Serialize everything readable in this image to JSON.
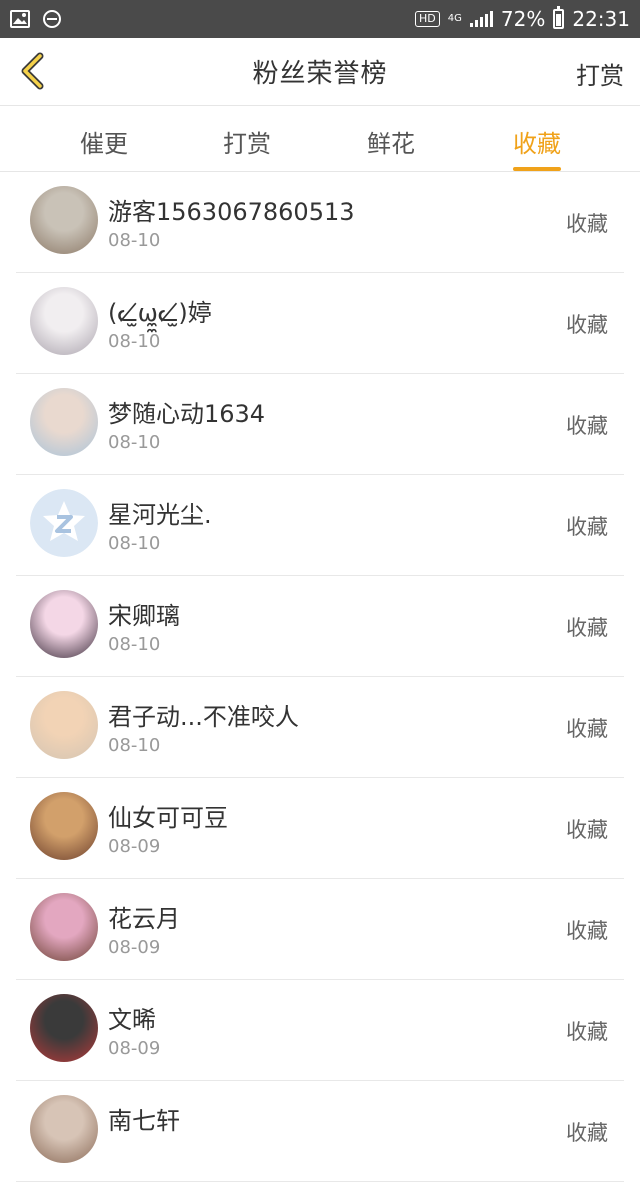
{
  "status_bar": {
    "hd": "HD",
    "network": "4G",
    "battery": "72%",
    "battery_level": 0.72,
    "time": "22:31",
    "icons": [
      "image-icon",
      "minus-circle-icon",
      "signal-icon",
      "battery-icon"
    ]
  },
  "header": {
    "title": "粉丝荣誉榜",
    "action": "打赏",
    "back_icon": "chevron-left-icon",
    "accent": "#f0a21a"
  },
  "tabs": [
    {
      "label": "催更",
      "active": false
    },
    {
      "label": "打赏",
      "active": false
    },
    {
      "label": "鲜花",
      "active": false
    },
    {
      "label": "收藏",
      "active": true
    }
  ],
  "fans": [
    {
      "name": "游客1563067860513",
      "date": "08-10",
      "action": "收藏",
      "avatar_colors": [
        "#c9c2b7",
        "#8b7866"
      ]
    },
    {
      "name": "(ᓚ̸̫ω̼̼ᓚ̸̫)婷",
      "date": "08-10",
      "action": "收藏",
      "avatar_colors": [
        "#f1eef0",
        "#aaa3ad"
      ]
    },
    {
      "name": "梦随心动1634",
      "date": "08-10",
      "action": "收藏",
      "avatar_colors": [
        "#e9d9cf",
        "#a9c3d9"
      ]
    },
    {
      "name": "星河光尘.",
      "date": "08-10",
      "action": "收藏",
      "avatar_colors": [
        "#dce8f5",
        "#dce8f5"
      ]
    },
    {
      "name": "宋卿璃",
      "date": "08-10",
      "action": "收藏",
      "avatar_colors": [
        "#f4d7e6",
        "#3a2c3a"
      ]
    },
    {
      "name": "君子动...不准咬人",
      "date": "08-10",
      "action": "收藏",
      "avatar_colors": [
        "#f2d3b5",
        "#d3c4b2"
      ]
    },
    {
      "name": "仙女可可豆",
      "date": "08-09",
      "action": "收藏",
      "avatar_colors": [
        "#d2a06b",
        "#6b3e2c"
      ]
    },
    {
      "name": "花云月",
      "date": "08-09",
      "action": "收藏",
      "avatar_colors": [
        "#e3a7c0",
        "#6b4032"
      ]
    },
    {
      "name": "文晞",
      "date": "08-09",
      "action": "收藏",
      "avatar_colors": [
        "#3a3a3a",
        "#b73a3a"
      ]
    },
    {
      "name": "南七轩",
      "date": "",
      "action": "收藏",
      "avatar_colors": [
        "#d7c4b6",
        "#8a6a57"
      ]
    }
  ]
}
